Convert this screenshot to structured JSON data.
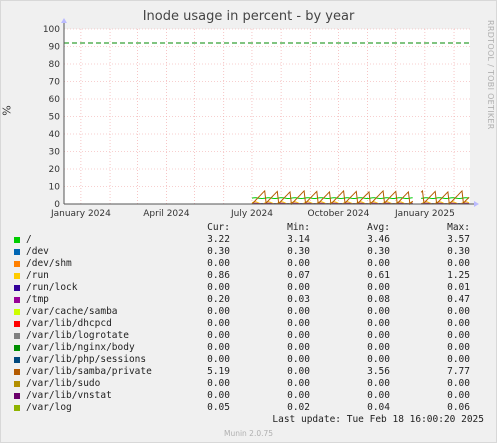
{
  "chart_data": {
    "type": "line",
    "title": "Inode usage in percent - by year",
    "ylabel": "%",
    "ylim": [
      0,
      100
    ],
    "y_ticks": [
      "0",
      "10",
      "20",
      "30",
      "40",
      "50",
      "60",
      "70",
      "80",
      "90",
      "100"
    ],
    "x_ticks": [
      "January 2024",
      "April 2024",
      "July 2024",
      "October 2024",
      "January 2025"
    ],
    "xlim": [
      "2023-12-14",
      "2025-02-18"
    ],
    "grid": true,
    "warning_level": 92,
    "warning_color": "#008800",
    "series": [
      {
        "name": "/",
        "color": "#00cc00",
        "cur": "3.22",
        "min": "3.14",
        "avg": "3.46",
        "max": "3.57"
      },
      {
        "name": "/dev",
        "color": "#0066b3",
        "cur": "0.30",
        "min": "0.30",
        "avg": "0.30",
        "max": "0.30"
      },
      {
        "name": "/dev/shm",
        "color": "#ff8000",
        "cur": "0.00",
        "min": "0.00",
        "avg": "0.00",
        "max": "0.00"
      },
      {
        "name": "/run",
        "color": "#ffcc00",
        "cur": "0.86",
        "min": "0.07",
        "avg": "0.61",
        "max": "1.25"
      },
      {
        "name": "/run/lock",
        "color": "#330099",
        "cur": "0.00",
        "min": "0.00",
        "avg": "0.00",
        "max": "0.01"
      },
      {
        "name": "/tmp",
        "color": "#990099",
        "cur": "0.20",
        "min": "0.03",
        "avg": "0.08",
        "max": "0.47"
      },
      {
        "name": "/var/cache/samba",
        "color": "#ccff00",
        "cur": "0.00",
        "min": "0.00",
        "avg": "0.00",
        "max": "0.00"
      },
      {
        "name": "/var/lib/dhcpcd",
        "color": "#ff0000",
        "cur": "0.00",
        "min": "0.00",
        "avg": "0.00",
        "max": "0.00"
      },
      {
        "name": "/var/lib/logrotate",
        "color": "#808080",
        "cur": "0.00",
        "min": "0.00",
        "avg": "0.00",
        "max": "0.00"
      },
      {
        "name": "/var/lib/nginx/body",
        "color": "#008f00",
        "cur": "0.00",
        "min": "0.00",
        "avg": "0.00",
        "max": "0.00"
      },
      {
        "name": "/var/lib/php/sessions",
        "color": "#00487d",
        "cur": "0.00",
        "min": "0.00",
        "avg": "0.00",
        "max": "0.00"
      },
      {
        "name": "/var/lib/samba/private",
        "color": "#b35a00",
        "cur": "5.19",
        "min": "0.00",
        "avg": "3.56",
        "max": "7.77"
      },
      {
        "name": "/var/lib/sudo",
        "color": "#b38f00",
        "cur": "0.00",
        "min": "0.00",
        "avg": "0.00",
        "max": "0.00"
      },
      {
        "name": "/var/lib/vnstat",
        "color": "#6b006b",
        "cur": "0.00",
        "min": "0.00",
        "avg": "0.00",
        "max": "0.00"
      },
      {
        "name": "/var/log",
        "color": "#8fb300",
        "cur": "0.05",
        "min": "0.02",
        "avg": "0.04",
        "max": "0.06"
      }
    ],
    "data_start": "2024-07-01",
    "data_gap": [
      "2024-12-20",
      "2024-12-28"
    ]
  },
  "legend_headers": {
    "cur": "Cur:",
    "min": "Min:",
    "avg": "Avg:",
    "max": "Max:"
  },
  "footer": {
    "last_update": "Last update: Tue Feb 18 16:00:20 2025",
    "munin": "Munin 2.0.75"
  },
  "side_label": "RRDTOOL / TOBI OETIKER"
}
